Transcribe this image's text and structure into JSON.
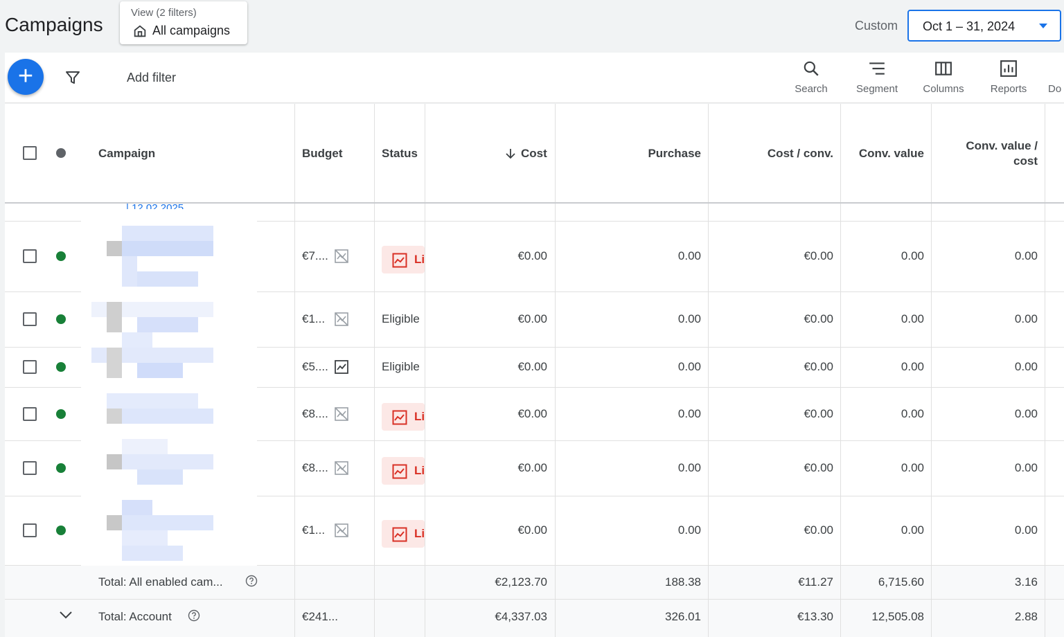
{
  "header": {
    "title": "Campaigns",
    "view_label": "View (2 filters)",
    "view_name": "All campaigns",
    "date_preset": "Custom",
    "date_range": "Oct 1 – 31, 2024"
  },
  "toolbar": {
    "add_filter": "Add filter",
    "tools": [
      "Search",
      "Segment",
      "Columns",
      "Reports",
      "Do"
    ]
  },
  "table": {
    "columns": {
      "campaign": "Campaign",
      "budget": "Budget",
      "status": "Status",
      "cost": "Cost",
      "purchase": "Purchase",
      "cost_conv": "Cost / conv.",
      "conv_value": "Conv. value",
      "conv_value_cost_1": "Conv. value /",
      "conv_value_cost_2": "cost"
    },
    "partial_row_text": "| 12.02.2025",
    "rows": [
      {
        "budget": "€7....",
        "status": "Li",
        "cost": "€0.00",
        "purchase": "0.00",
        "cost_conv": "€0.00",
        "conv_value": "0.00",
        "conv_value_cost": "0.00"
      },
      {
        "budget": "€1...",
        "status": "Eligible",
        "cost": "€0.00",
        "purchase": "0.00",
        "cost_conv": "€0.00",
        "conv_value": "0.00",
        "conv_value_cost": "0.00"
      },
      {
        "budget": "€5....",
        "status": "Eligible",
        "cost": "€0.00",
        "purchase": "0.00",
        "cost_conv": "€0.00",
        "conv_value": "0.00",
        "conv_value_cost": "0.00"
      },
      {
        "budget": "€8....",
        "status": "Li",
        "cost": "€0.00",
        "purchase": "0.00",
        "cost_conv": "€0.00",
        "conv_value": "0.00",
        "conv_value_cost": "0.00"
      },
      {
        "budget": "€8....",
        "status": "Li",
        "cost": "€0.00",
        "purchase": "0.00",
        "cost_conv": "€0.00",
        "conv_value": "0.00",
        "conv_value_cost": "0.00"
      },
      {
        "budget": "€1...",
        "status": "Li",
        "cost": "€0.00",
        "purchase": "0.00",
        "cost_conv": "€0.00",
        "conv_value": "0.00",
        "conv_value_cost": "0.00"
      }
    ],
    "totals": [
      {
        "label": "Total: All enabled cam...",
        "budget": "",
        "cost": "€2,123.70",
        "purchase": "188.38",
        "cost_conv": "€11.27",
        "conv_value": "6,715.60",
        "conv_value_cost": "3.16"
      },
      {
        "label": "Total: Account",
        "budget": "€241...",
        "cost": "€4,337.03",
        "purchase": "326.01",
        "cost_conv": "€13.30",
        "conv_value": "12,505.08",
        "conv_value_cost": "2.88"
      }
    ]
  },
  "colors": {
    "accent": "#1a73e8",
    "enabled_dot": "#188038",
    "limited_bg": "#fce8e6",
    "limited_text": "#d93025"
  }
}
